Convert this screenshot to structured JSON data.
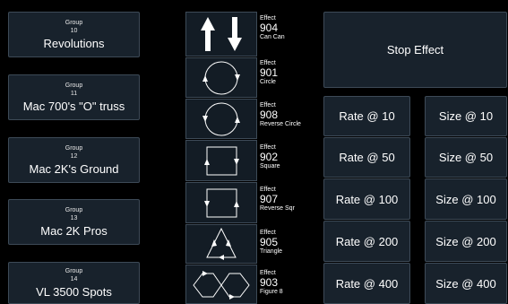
{
  "groups": [
    {
      "type": "Group",
      "num": "10",
      "name": "Revolutions"
    },
    {
      "type": "Group",
      "num": "11",
      "name": "Mac 700's \"O\" truss"
    },
    {
      "type": "Group",
      "num": "12",
      "name": "Mac 2K's Ground"
    },
    {
      "type": "Group",
      "num": "13",
      "name": "Mac 2K Pros"
    },
    {
      "type": "Group",
      "num": "14",
      "name": "VL 3500 Spots"
    }
  ],
  "effects": [
    {
      "type": "Effect",
      "num": "904",
      "name": "Can Can",
      "icon": "up-down-arrows-icon"
    },
    {
      "type": "Effect",
      "num": "901",
      "name": "Circle",
      "icon": "circle-icon"
    },
    {
      "type": "Effect",
      "num": "908",
      "name": "Reverse Circle",
      "icon": "reverse-circle-icon"
    },
    {
      "type": "Effect",
      "num": "902",
      "name": "Square",
      "icon": "square-icon"
    },
    {
      "type": "Effect",
      "num": "907",
      "name": "Reverse Sqr",
      "icon": "reverse-square-icon"
    },
    {
      "type": "Effect",
      "num": "905",
      "name": "Triangle",
      "icon": "triangle-icon"
    },
    {
      "type": "Effect",
      "num": "903",
      "name": "Figure 8",
      "icon": "figure-8-icon"
    }
  ],
  "stop_effect": "Stop Effect",
  "rates": [
    "Rate @ 10",
    "Rate @ 50",
    "Rate @ 100",
    "Rate @ 200",
    "Rate @ 400"
  ],
  "sizes": [
    "Size @ 10",
    "Size @ 50",
    "Size @ 100",
    "Size @ 200",
    "Size @ 400"
  ],
  "colors": {
    "background": "#000000",
    "button": "#18222c",
    "border": "#3d4a57"
  }
}
